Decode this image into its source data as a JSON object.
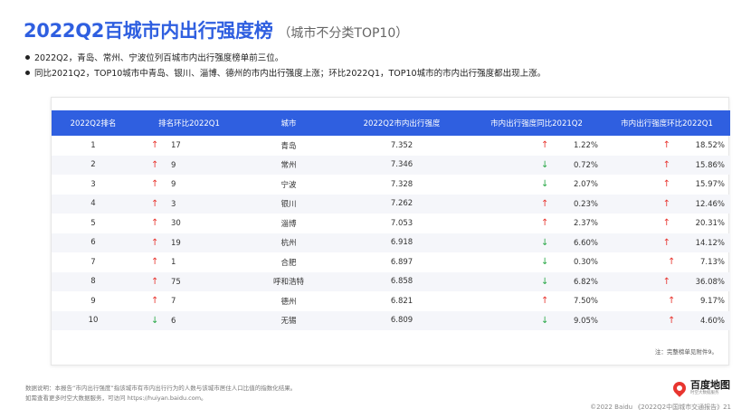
{
  "header": {
    "title": "2022Q2百城市内出行强度榜",
    "subtitle": "（城市不分类TOP10）"
  },
  "bullets": [
    "2022Q2，青岛、常州、宁波位列百城市内出行强度榜单前三位。",
    "同比2021Q2，TOP10城市中青岛、银川、淄博、德州的市内出行强度上涨；环比2022Q1，TOP10城市的市内出行强度都出现上涨。"
  ],
  "table": {
    "columns": [
      "2022Q2排名",
      "排名环比2022Q1",
      "城市",
      "2022Q2市内出行强度",
      "市内出行强度同比2021Q2",
      "市内出行强度环比2022Q1"
    ],
    "rows": [
      {
        "rank": "1",
        "rank_dir": "up",
        "rank_arrow": "↑",
        "rank_change": "17",
        "city": "青岛",
        "intensity": "7.352",
        "yoy_dir": "up",
        "yoy_arrow": "↑",
        "yoy": "1.22%",
        "qoq_dir": "up",
        "qoq_arrow": "↑",
        "qoq": "18.52%"
      },
      {
        "rank": "2",
        "rank_dir": "up",
        "rank_arrow": "↑",
        "rank_change": "9",
        "city": "常州",
        "intensity": "7.346",
        "yoy_dir": "down",
        "yoy_arrow": "↓",
        "yoy": "0.72%",
        "qoq_dir": "up",
        "qoq_arrow": "↑",
        "qoq": "15.86%"
      },
      {
        "rank": "3",
        "rank_dir": "up",
        "rank_arrow": "↑",
        "rank_change": "9",
        "city": "宁波",
        "intensity": "7.328",
        "yoy_dir": "down",
        "yoy_arrow": "↓",
        "yoy": "2.07%",
        "qoq_dir": "up",
        "qoq_arrow": "↑",
        "qoq": "15.97%"
      },
      {
        "rank": "4",
        "rank_dir": "up",
        "rank_arrow": "↑",
        "rank_change": "3",
        "city": "银川",
        "intensity": "7.262",
        "yoy_dir": "up",
        "yoy_arrow": "↑",
        "yoy": "0.23%",
        "qoq_dir": "up",
        "qoq_arrow": "↑",
        "qoq": "12.46%"
      },
      {
        "rank": "5",
        "rank_dir": "up",
        "rank_arrow": "↑",
        "rank_change": "30",
        "city": "淄博",
        "intensity": "7.053",
        "yoy_dir": "up",
        "yoy_arrow": "↑",
        "yoy": "2.37%",
        "qoq_dir": "up",
        "qoq_arrow": "↑",
        "qoq": "20.31%"
      },
      {
        "rank": "6",
        "rank_dir": "up",
        "rank_arrow": "↑",
        "rank_change": "19",
        "city": "杭州",
        "intensity": "6.918",
        "yoy_dir": "down",
        "yoy_arrow": "↓",
        "yoy": "6.60%",
        "qoq_dir": "up",
        "qoq_arrow": "↑",
        "qoq": "14.12%"
      },
      {
        "rank": "7",
        "rank_dir": "up",
        "rank_arrow": "↑",
        "rank_change": "1",
        "city": "合肥",
        "intensity": "6.897",
        "yoy_dir": "down",
        "yoy_arrow": "↓",
        "yoy": "0.30%",
        "qoq_dir": "up",
        "qoq_arrow": "↑",
        "qoq": "7.13%"
      },
      {
        "rank": "8",
        "rank_dir": "up",
        "rank_arrow": "↑",
        "rank_change": "75",
        "city": "呼和浩特",
        "intensity": "6.858",
        "yoy_dir": "down",
        "yoy_arrow": "↓",
        "yoy": "6.82%",
        "qoq_dir": "up",
        "qoq_arrow": "↑",
        "qoq": "36.08%"
      },
      {
        "rank": "9",
        "rank_dir": "up",
        "rank_arrow": "↑",
        "rank_change": "7",
        "city": "德州",
        "intensity": "6.821",
        "yoy_dir": "up",
        "yoy_arrow": "↑",
        "yoy": "7.50%",
        "qoq_dir": "up",
        "qoq_arrow": "↑",
        "qoq": "9.17%"
      },
      {
        "rank": "10",
        "rank_dir": "down",
        "rank_arrow": "↓",
        "rank_change": "6",
        "city": "无锡",
        "intensity": "6.809",
        "yoy_dir": "down",
        "yoy_arrow": "↓",
        "yoy": "9.05%",
        "qoq_dir": "up",
        "qoq_arrow": "↑",
        "qoq": "4.60%"
      }
    ],
    "note": "注：完整榜单见附件9。"
  },
  "footer": {
    "line1": "数据说明：本报告“市内出行强度”指该城市有市内出行行为的人数与该城市居住人口比值的指数化结果。",
    "line2": "如需查看更多时空大数据服务，可访问 https://huiyan.baidu.com。"
  },
  "logo": {
    "main": "百度地图",
    "sub": "时空大数据服务"
  },
  "copyright": "©2022 Baidu 《2022Q2中国城市交通报告》21",
  "colors": {
    "accent": "#2f5fe0",
    "up": "#e8352f",
    "down": "#2aa847"
  }
}
